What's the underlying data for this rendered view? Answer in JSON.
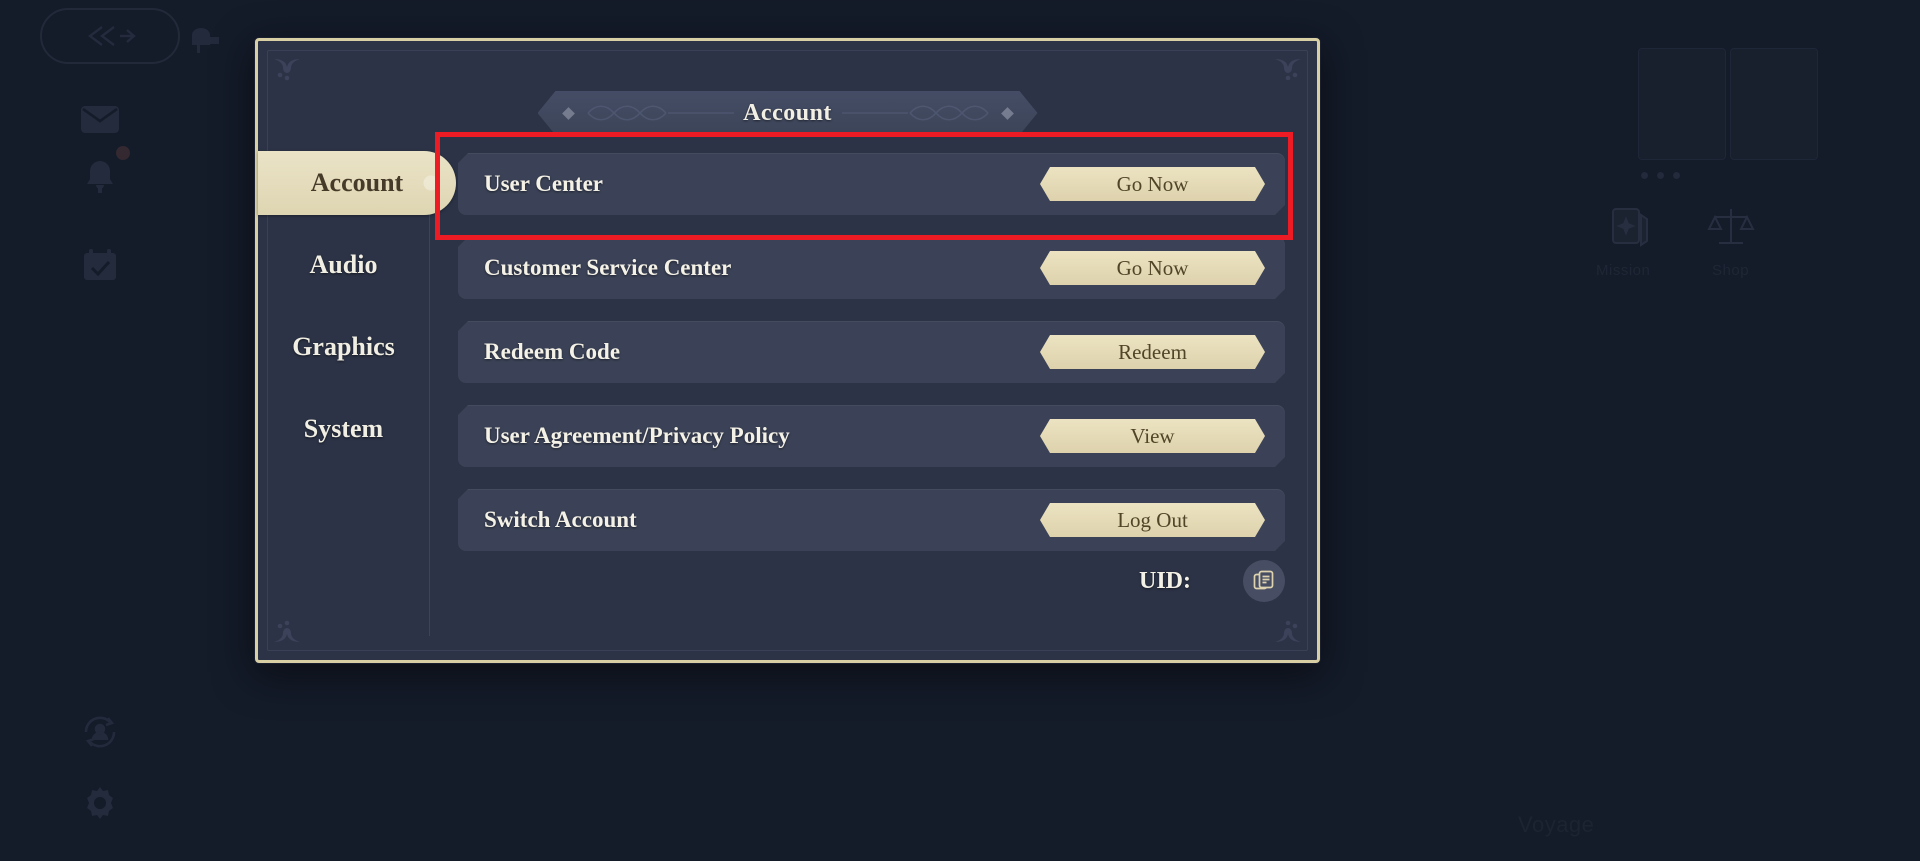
{
  "panel": {
    "title": "Account",
    "corner_ornament_icon": "floral-corner-icon"
  },
  "sidebar": {
    "items": [
      {
        "label": "Account",
        "active": true
      },
      {
        "label": "Audio",
        "active": false
      },
      {
        "label": "Graphics",
        "active": false
      },
      {
        "label": "System",
        "active": false
      }
    ]
  },
  "main": {
    "rows": [
      {
        "label": "User Center",
        "button": "Go Now",
        "highlighted": true
      },
      {
        "label": "Customer Service Center",
        "button": "Go Now",
        "highlighted": false
      },
      {
        "label": "Redeem Code",
        "button": "Redeem",
        "highlighted": false
      },
      {
        "label": "User Agreement/Privacy Policy",
        "button": "View",
        "highlighted": false
      },
      {
        "label": "Switch Account",
        "button": "Log Out",
        "highlighted": false
      }
    ],
    "uid": {
      "label": "UID:",
      "value": "",
      "copy_icon": "copy-document-icon"
    }
  },
  "annotation": {
    "color": "#ed1c24",
    "target": "User Center"
  },
  "background": {
    "left_icons": [
      {
        "name": "back-arrow-icon"
      },
      {
        "name": "mail-envelope-icon"
      },
      {
        "name": "bell-notification-icon"
      },
      {
        "name": "calendar-check-icon"
      },
      {
        "name": "character-switch-icon"
      },
      {
        "name": "gear-settings-icon"
      }
    ],
    "right_icons": [
      {
        "name": "cards-icon",
        "label": "Mission"
      },
      {
        "name": "scales-icon",
        "label": "Shop"
      }
    ],
    "bottom_label": "Voyage"
  },
  "colors": {
    "panel_bg": "#2c3346",
    "panel_border": "#d8cfa4",
    "row_bg": "#3b4257",
    "button_cream": "#e6dcb8",
    "button_text": "#514528",
    "text_light": "#f4f1e7",
    "page_bg": "#141b29",
    "annotation_red": "#ed1c24"
  }
}
